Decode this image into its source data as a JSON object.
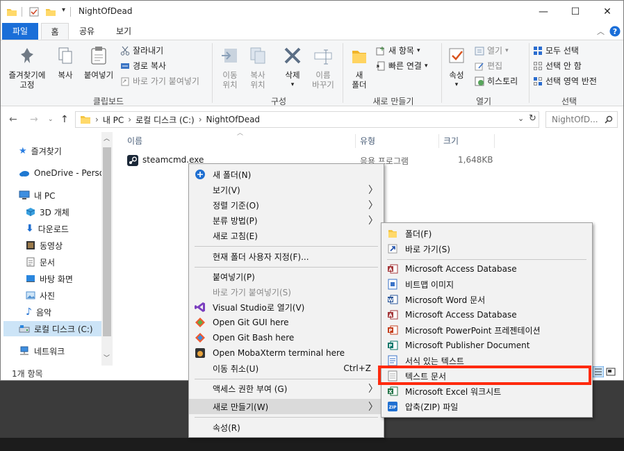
{
  "window": {
    "title": "NightOfDead",
    "minimize": "—",
    "maximize": "☐",
    "close": "✕"
  },
  "tabs": [
    "파일",
    "홈",
    "공유",
    "보기"
  ],
  "ribbon": {
    "clipboard": {
      "pin_label_1": "즐겨찾기에",
      "pin_label_2": "고정",
      "copy": "복사",
      "paste": "붙여넣기",
      "cut": "잘라내기",
      "copy_path": "경로 복사",
      "paste_shortcut": "바로 가기 붙여넣기",
      "group": "클립보드"
    },
    "organize": {
      "move_1": "이동",
      "move_2": "위치",
      "copy_1": "복사",
      "copy_2": "위치",
      "delete": "삭제",
      "rename_1": "이름",
      "rename_2": "바꾸기",
      "group": "구성"
    },
    "new": {
      "folder_1": "새",
      "folder_2": "폴더",
      "new_item": "새 항목",
      "easy_access": "빠른 연결",
      "group": "새로 만들기"
    },
    "open": {
      "properties": "속성",
      "open": "열기",
      "edit": "편집",
      "history": "히스토리",
      "group": "열기"
    },
    "select": {
      "select_all": "모두 선택",
      "select_none": "선택 안 함",
      "invert": "선택 영역 반전",
      "group": "선택"
    }
  },
  "address": {
    "breadcrumb": [
      "내 PC",
      "로컬 디스크 (C:)",
      "NightOfDead"
    ],
    "search_placeholder": "NightOfD..."
  },
  "nav_pane": {
    "items": [
      "즐겨찾기",
      "OneDrive - Person",
      "내 PC",
      "3D 개체",
      "다운로드",
      "동영상",
      "문서",
      "바탕 화면",
      "사진",
      "음악",
      "로컬 디스크 (C:)",
      "네트워크"
    ]
  },
  "columns": {
    "name": "이름",
    "type": "유형",
    "size": "크기"
  },
  "files": [
    {
      "name": "steamcmd.exe",
      "type": "응용 프로그램",
      "size": "1,648KB"
    }
  ],
  "status": {
    "count": "1개 항목"
  },
  "context_menu": {
    "items": [
      {
        "label": "새 폴더(N)"
      },
      {
        "label": "보기(V)"
      },
      {
        "label": "정렬 기준(O)"
      },
      {
        "label": "분류 방법(P)"
      },
      {
        "label": "새로 고침(E)"
      },
      {
        "label": "현재 폴더 사용자 지정(F)..."
      },
      {
        "label": "붙여넣기(P)"
      },
      {
        "label": "바로 가기 붙여넣기(S)"
      },
      {
        "label": "Visual Studio로 열기(V)"
      },
      {
        "label": "Open Git GUI here"
      },
      {
        "label": "Open Git Bash here"
      },
      {
        "label": "Open MobaXterm terminal here"
      },
      {
        "label": "이동 취소(U)",
        "shortcut": "Ctrl+Z"
      },
      {
        "label": "액세스 권한 부여 (G)"
      },
      {
        "label": "새로 만들기(W)"
      },
      {
        "label": "속성(R)"
      }
    ]
  },
  "submenu": {
    "items": [
      {
        "label": "폴더(F)"
      },
      {
        "label": "바로 가기(S)"
      },
      {
        "label": "Microsoft Access Database"
      },
      {
        "label": "비트맵 이미지"
      },
      {
        "label": "Microsoft Word 문서"
      },
      {
        "label": "Microsoft Access Database"
      },
      {
        "label": "Microsoft PowerPoint 프레젠테이션"
      },
      {
        "label": "Microsoft Publisher Document"
      },
      {
        "label": "서식 있는 텍스트"
      },
      {
        "label": "텍스트 문서"
      },
      {
        "label": "Microsoft Excel 워크시트"
      },
      {
        "label": "압축(ZIP) 파일"
      }
    ]
  },
  "colors": {
    "accent": "#1a6ed8",
    "highlight": "#ff2a0e"
  }
}
